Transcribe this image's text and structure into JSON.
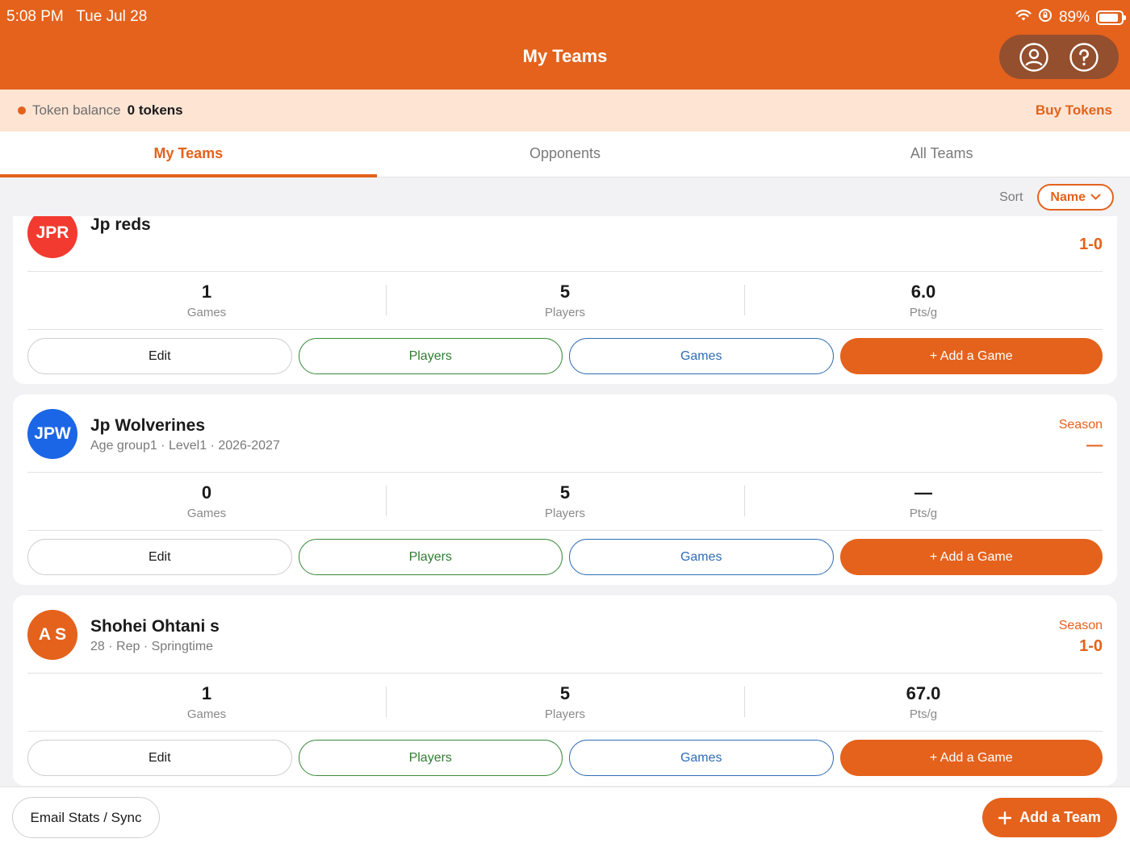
{
  "status_bar": {
    "time": "5:08 PM",
    "date": "Tue Jul 28",
    "battery": "89%",
    "battery_level": 0.89,
    "icons": [
      "wifi-icon",
      "orientation-lock-icon",
      "battery-icon"
    ]
  },
  "header": {
    "title": "My Teams",
    "icons": [
      "profile-icon",
      "help-icon"
    ]
  },
  "token_bar": {
    "label": "Token balance",
    "value": "0 tokens",
    "buy_label": "Buy Tokens"
  },
  "tabs": [
    {
      "label": "My Teams",
      "active": true
    },
    {
      "label": "Opponents",
      "active": false
    },
    {
      "label": "All Teams",
      "active": false
    }
  ],
  "sort": {
    "label": "Sort",
    "value": "Name"
  },
  "teams": [
    {
      "initials": "JPR",
      "avatar_color": "#f23a30",
      "name": "Jp reds",
      "meta": "",
      "season_label": "",
      "record": "1-0",
      "stats": [
        {
          "value": "1",
          "label": "Games"
        },
        {
          "value": "5",
          "label": "Players"
        },
        {
          "value": "6.0",
          "label": "Pts/g"
        }
      ],
      "actions": {
        "edit": "Edit",
        "players": "Players",
        "games": "Games",
        "add_game": "+ Add a Game"
      }
    },
    {
      "initials": "JPW",
      "avatar_color": "#1b66e6",
      "name": "Jp Wolverines",
      "meta": "Age group1 · Level1 · 2026-2027",
      "season_label": "Season",
      "record": "—",
      "stats": [
        {
          "value": "0",
          "label": "Games"
        },
        {
          "value": "5",
          "label": "Players"
        },
        {
          "value": "—",
          "label": "Pts/g"
        }
      ],
      "actions": {
        "edit": "Edit",
        "players": "Players",
        "games": "Games",
        "add_game": "+ Add a Game"
      }
    },
    {
      "initials": "A S",
      "avatar_color": "#e4621c",
      "name": "Shohei Ohtani s",
      "meta": "28 · Rep · Springtime",
      "season_label": "Season",
      "record": "1-0",
      "stats": [
        {
          "value": "1",
          "label": "Games"
        },
        {
          "value": "5",
          "label": "Players"
        },
        {
          "value": "67.0",
          "label": "Pts/g"
        }
      ],
      "actions": {
        "edit": "Edit",
        "players": "Players",
        "games": "Games",
        "add_game": "+ Add a Game"
      }
    }
  ],
  "footer": {
    "email_label": "Email Stats / Sync",
    "add_team_label": "Add a Team"
  },
  "colors": {
    "accent": "#e4621c",
    "token_bg": "#fde4d3",
    "players_green": "#2f7d2f",
    "games_blue": "#2f6db5"
  }
}
